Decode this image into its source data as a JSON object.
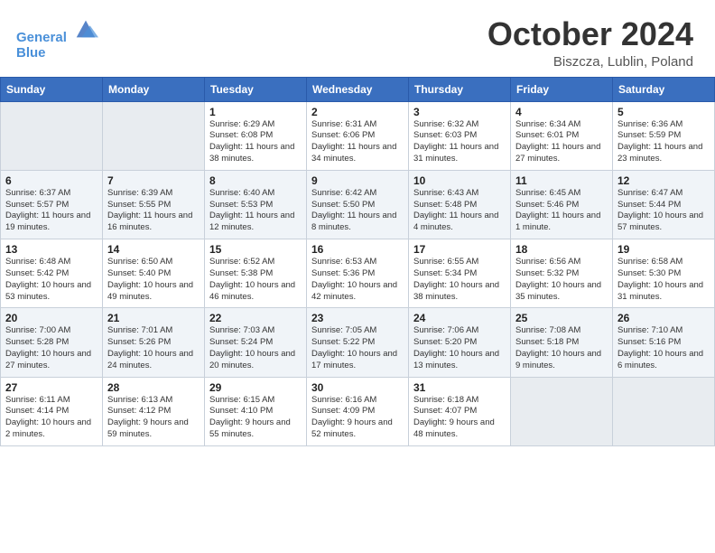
{
  "header": {
    "logo_line1": "General",
    "logo_line2": "Blue",
    "title": "October 2024",
    "location": "Biszcza, Lublin, Poland"
  },
  "weekdays": [
    "Sunday",
    "Monday",
    "Tuesday",
    "Wednesday",
    "Thursday",
    "Friday",
    "Saturday"
  ],
  "weeks": [
    [
      {
        "day": "",
        "sunrise": "",
        "sunset": "",
        "daylight": ""
      },
      {
        "day": "",
        "sunrise": "",
        "sunset": "",
        "daylight": ""
      },
      {
        "day": "1",
        "sunrise": "Sunrise: 6:29 AM",
        "sunset": "Sunset: 6:08 PM",
        "daylight": "Daylight: 11 hours and 38 minutes."
      },
      {
        "day": "2",
        "sunrise": "Sunrise: 6:31 AM",
        "sunset": "Sunset: 6:06 PM",
        "daylight": "Daylight: 11 hours and 34 minutes."
      },
      {
        "day": "3",
        "sunrise": "Sunrise: 6:32 AM",
        "sunset": "Sunset: 6:03 PM",
        "daylight": "Daylight: 11 hours and 31 minutes."
      },
      {
        "day": "4",
        "sunrise": "Sunrise: 6:34 AM",
        "sunset": "Sunset: 6:01 PM",
        "daylight": "Daylight: 11 hours and 27 minutes."
      },
      {
        "day": "5",
        "sunrise": "Sunrise: 6:36 AM",
        "sunset": "Sunset: 5:59 PM",
        "daylight": "Daylight: 11 hours and 23 minutes."
      }
    ],
    [
      {
        "day": "6",
        "sunrise": "Sunrise: 6:37 AM",
        "sunset": "Sunset: 5:57 PM",
        "daylight": "Daylight: 11 hours and 19 minutes."
      },
      {
        "day": "7",
        "sunrise": "Sunrise: 6:39 AM",
        "sunset": "Sunset: 5:55 PM",
        "daylight": "Daylight: 11 hours and 16 minutes."
      },
      {
        "day": "8",
        "sunrise": "Sunrise: 6:40 AM",
        "sunset": "Sunset: 5:53 PM",
        "daylight": "Daylight: 11 hours and 12 minutes."
      },
      {
        "day": "9",
        "sunrise": "Sunrise: 6:42 AM",
        "sunset": "Sunset: 5:50 PM",
        "daylight": "Daylight: 11 hours and 8 minutes."
      },
      {
        "day": "10",
        "sunrise": "Sunrise: 6:43 AM",
        "sunset": "Sunset: 5:48 PM",
        "daylight": "Daylight: 11 hours and 4 minutes."
      },
      {
        "day": "11",
        "sunrise": "Sunrise: 6:45 AM",
        "sunset": "Sunset: 5:46 PM",
        "daylight": "Daylight: 11 hours and 1 minute."
      },
      {
        "day": "12",
        "sunrise": "Sunrise: 6:47 AM",
        "sunset": "Sunset: 5:44 PM",
        "daylight": "Daylight: 10 hours and 57 minutes."
      }
    ],
    [
      {
        "day": "13",
        "sunrise": "Sunrise: 6:48 AM",
        "sunset": "Sunset: 5:42 PM",
        "daylight": "Daylight: 10 hours and 53 minutes."
      },
      {
        "day": "14",
        "sunrise": "Sunrise: 6:50 AM",
        "sunset": "Sunset: 5:40 PM",
        "daylight": "Daylight: 10 hours and 49 minutes."
      },
      {
        "day": "15",
        "sunrise": "Sunrise: 6:52 AM",
        "sunset": "Sunset: 5:38 PM",
        "daylight": "Daylight: 10 hours and 46 minutes."
      },
      {
        "day": "16",
        "sunrise": "Sunrise: 6:53 AM",
        "sunset": "Sunset: 5:36 PM",
        "daylight": "Daylight: 10 hours and 42 minutes."
      },
      {
        "day": "17",
        "sunrise": "Sunrise: 6:55 AM",
        "sunset": "Sunset: 5:34 PM",
        "daylight": "Daylight: 10 hours and 38 minutes."
      },
      {
        "day": "18",
        "sunrise": "Sunrise: 6:56 AM",
        "sunset": "Sunset: 5:32 PM",
        "daylight": "Daylight: 10 hours and 35 minutes."
      },
      {
        "day": "19",
        "sunrise": "Sunrise: 6:58 AM",
        "sunset": "Sunset: 5:30 PM",
        "daylight": "Daylight: 10 hours and 31 minutes."
      }
    ],
    [
      {
        "day": "20",
        "sunrise": "Sunrise: 7:00 AM",
        "sunset": "Sunset: 5:28 PM",
        "daylight": "Daylight: 10 hours and 27 minutes."
      },
      {
        "day": "21",
        "sunrise": "Sunrise: 7:01 AM",
        "sunset": "Sunset: 5:26 PM",
        "daylight": "Daylight: 10 hours and 24 minutes."
      },
      {
        "day": "22",
        "sunrise": "Sunrise: 7:03 AM",
        "sunset": "Sunset: 5:24 PM",
        "daylight": "Daylight: 10 hours and 20 minutes."
      },
      {
        "day": "23",
        "sunrise": "Sunrise: 7:05 AM",
        "sunset": "Sunset: 5:22 PM",
        "daylight": "Daylight: 10 hours and 17 minutes."
      },
      {
        "day": "24",
        "sunrise": "Sunrise: 7:06 AM",
        "sunset": "Sunset: 5:20 PM",
        "daylight": "Daylight: 10 hours and 13 minutes."
      },
      {
        "day": "25",
        "sunrise": "Sunrise: 7:08 AM",
        "sunset": "Sunset: 5:18 PM",
        "daylight": "Daylight: 10 hours and 9 minutes."
      },
      {
        "day": "26",
        "sunrise": "Sunrise: 7:10 AM",
        "sunset": "Sunset: 5:16 PM",
        "daylight": "Daylight: 10 hours and 6 minutes."
      }
    ],
    [
      {
        "day": "27",
        "sunrise": "Sunrise: 6:11 AM",
        "sunset": "Sunset: 4:14 PM",
        "daylight": "Daylight: 10 hours and 2 minutes."
      },
      {
        "day": "28",
        "sunrise": "Sunrise: 6:13 AM",
        "sunset": "Sunset: 4:12 PM",
        "daylight": "Daylight: 9 hours and 59 minutes."
      },
      {
        "day": "29",
        "sunrise": "Sunrise: 6:15 AM",
        "sunset": "Sunset: 4:10 PM",
        "daylight": "Daylight: 9 hours and 55 minutes."
      },
      {
        "day": "30",
        "sunrise": "Sunrise: 6:16 AM",
        "sunset": "Sunset: 4:09 PM",
        "daylight": "Daylight: 9 hours and 52 minutes."
      },
      {
        "day": "31",
        "sunrise": "Sunrise: 6:18 AM",
        "sunset": "Sunset: 4:07 PM",
        "daylight": "Daylight: 9 hours and 48 minutes."
      },
      {
        "day": "",
        "sunrise": "",
        "sunset": "",
        "daylight": ""
      },
      {
        "day": "",
        "sunrise": "",
        "sunset": "",
        "daylight": ""
      }
    ]
  ]
}
